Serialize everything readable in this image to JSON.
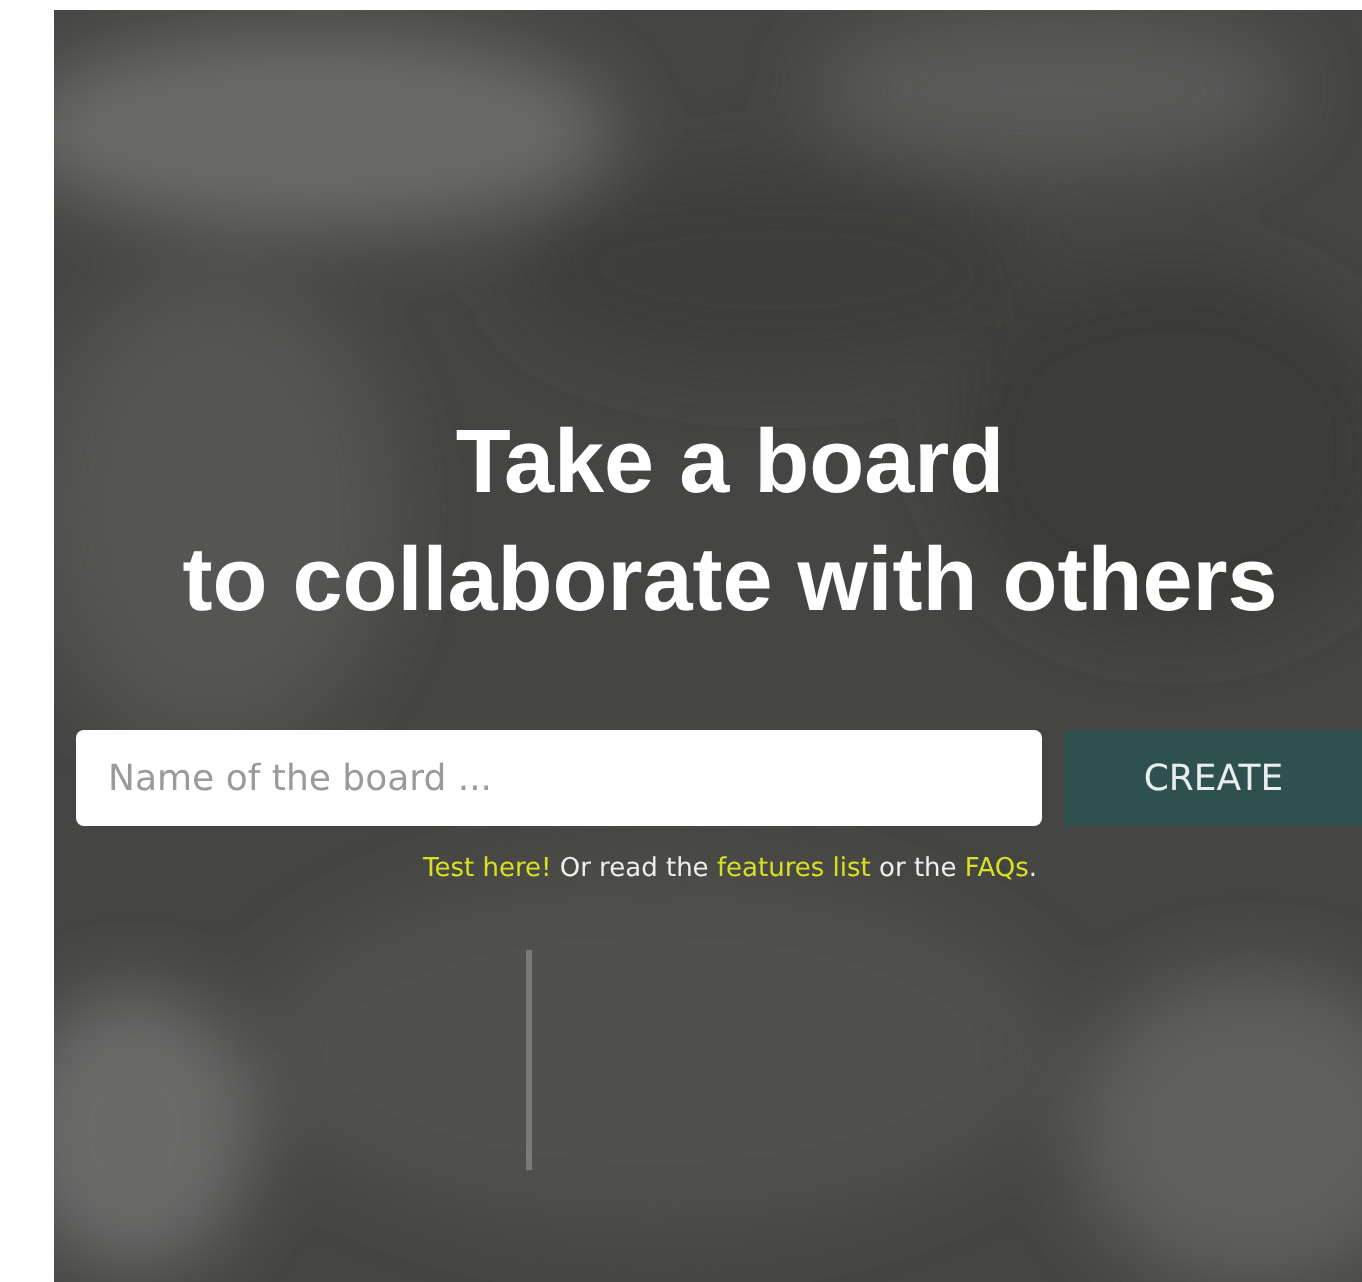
{
  "headline": [
    "Take a board",
    "to collaborate with others"
  ],
  "board_form": {
    "placeholder": "Name of the board ...",
    "button": "CREATE"
  },
  "help_line": [
    {
      "kind": "link",
      "text": "Test here!"
    },
    {
      "kind": "text",
      "text": " Or read the "
    },
    {
      "kind": "link",
      "text": "features list"
    },
    {
      "kind": "text",
      "text": " or the "
    },
    {
      "kind": "link",
      "text": "FAQs"
    },
    {
      "kind": "text",
      "text": "."
    }
  ]
}
